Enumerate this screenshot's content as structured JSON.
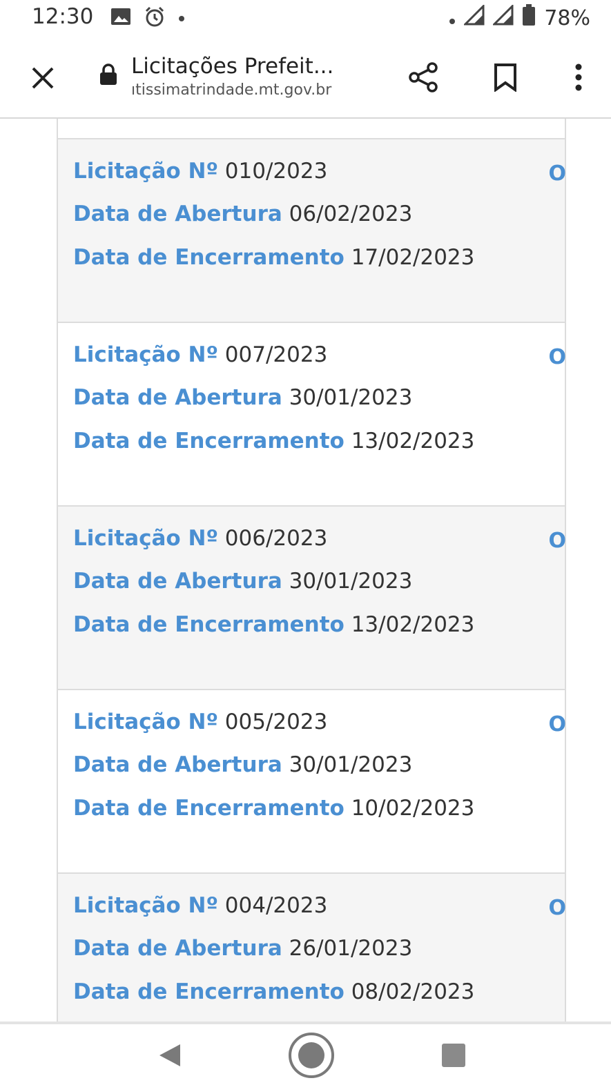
{
  "status": {
    "time": "12:30",
    "battery": "78%",
    "icons_left": [
      "image-icon",
      "alarm-icon",
      "dot-icon"
    ],
    "icons_right": [
      "dot-icon",
      "signal-icon",
      "signal-icon",
      "battery-icon"
    ]
  },
  "toolbar": {
    "title": "Licitações Prefeit...",
    "url": "ıtissimatrindade.mt.gov.br"
  },
  "labels": {
    "licitacao": "Licitação Nº",
    "abertura": "Data de Abertura",
    "encerramento": "Data de Encerramento",
    "marker": "O"
  },
  "cards": [
    {
      "numero": "010/2023",
      "abertura": "06/02/2023",
      "encerramento": "17/02/2023"
    },
    {
      "numero": "007/2023",
      "abertura": "30/01/2023",
      "encerramento": "13/02/2023"
    },
    {
      "numero": "006/2023",
      "abertura": "30/01/2023",
      "encerramento": "13/02/2023"
    },
    {
      "numero": "005/2023",
      "abertura": "30/01/2023",
      "encerramento": "10/02/2023"
    },
    {
      "numero": "004/2023",
      "abertura": "26/01/2023",
      "encerramento": "08/02/2023"
    }
  ],
  "colors": {
    "label_blue": "#4a8fd2",
    "card_shade": "#f5f5f5",
    "text_dark": "#333333"
  }
}
